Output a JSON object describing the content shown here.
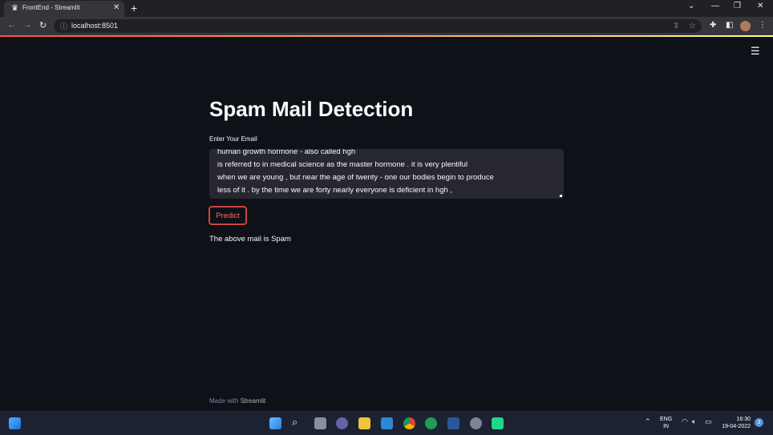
{
  "browser": {
    "tab_title": "FrontEnd - Streamlit",
    "tab_close": "✕",
    "new_tab": "+",
    "url": "localhost:8501",
    "win_minimize": "—",
    "win_restore": "❐",
    "win_close": "✕",
    "win_dropdown": "⌄"
  },
  "app": {
    "title": "Spam Mail Detection",
    "input_label": "Enter Your Email",
    "email_lines": [
      "human growth hormone - also called hgh",
      "is referred to in medical science as the master hormone . it is very plentiful",
      "when we are young , but near the age of twenty - one our bodies begin to produce",
      "less of it . by the time we are forty nearly everyone is deficient in hgh ,"
    ],
    "predict_label": "Predict",
    "result_text": "The above mail is Spam",
    "footer_prefix": "Made with",
    "footer_brand": "Streamlit"
  },
  "taskbar": {
    "lang_top": "ENG",
    "lang_bottom": "IN",
    "time": "16:30",
    "date": "19-04-2022",
    "notifications": "3"
  },
  "colors": {
    "accent": "#ff4b4b",
    "background": "#0e1117",
    "input_bg": "#262730"
  }
}
